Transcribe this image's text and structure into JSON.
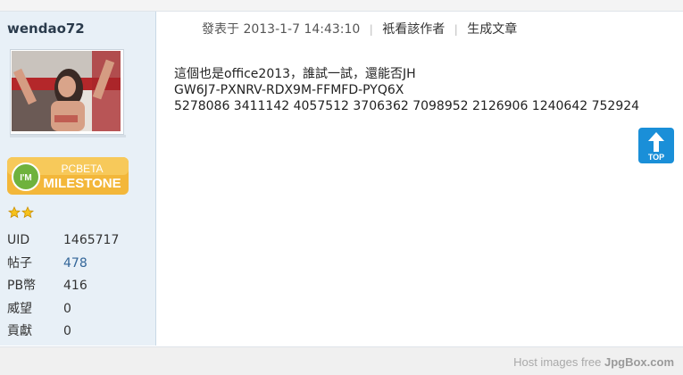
{
  "user": {
    "username": "wendao72",
    "badge_line1": "PCBETA",
    "badge_line2": "MILESTONE",
    "badge_mark": "I'M",
    "stats": [
      {
        "label": "UID",
        "value": "1465717"
      },
      {
        "label": "帖子",
        "value": "478"
      },
      {
        "label": "PB幣",
        "value": "416"
      },
      {
        "label": "威望",
        "value": "0"
      },
      {
        "label": "貢獻",
        "value": "0"
      }
    ]
  },
  "post": {
    "posted_prefix": "發表于",
    "posted_time": "2013-1-7 14:43:10",
    "only_author_label": "衹看該作者",
    "generate_article_label": "生成文章",
    "lines": [
      "這個也是office2013，誰試一試，還能否JH",
      "GW6J7-PXNRV-RDX9M-FFMFD-PYQ6X",
      "5278086  3411142  4057512  3706362  7098952  2126906  1240642  752924"
    ]
  },
  "top_button": {
    "label": "TOP"
  },
  "footer": {
    "watermark_text": "Host images free",
    "watermark_brand": "JpgBox.com"
  },
  "colors": {
    "sidebar_bg": "#e8f0f7",
    "link": "#336699",
    "top_button": "#1a8fd8",
    "badge": "#f3b73a"
  }
}
